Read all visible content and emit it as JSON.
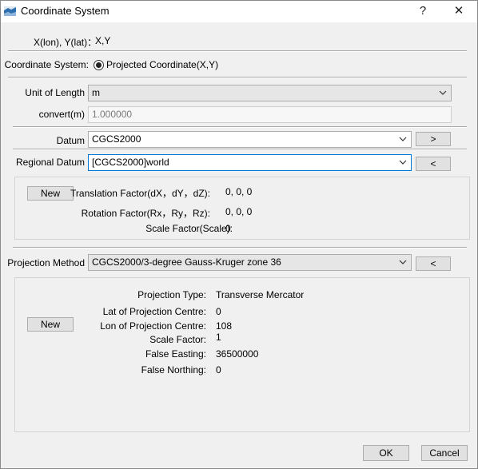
{
  "window": {
    "title": "Coordinate System",
    "help": "?",
    "close": "✕"
  },
  "xy_header": {
    "label": "X(lon), Y(lat)：",
    "value": "X,Y"
  },
  "coordinate_system": {
    "label": "Coordinate System:",
    "option": "Projected Coordinate(X,Y)",
    "selected": true
  },
  "unit": {
    "label": "Unit of Length",
    "value": "m",
    "convert_label": "convert(m)",
    "convert_value": "1.000000"
  },
  "datum": {
    "label": "Datum",
    "value": "CGCS2000",
    "button": ">"
  },
  "regional_datum": {
    "label": "Regional Datum",
    "value": "[CGCS2000]world",
    "button": "<",
    "new_button": "New",
    "translation_label": "Translation Factor(dX，dY，dZ):",
    "translation_value": "0, 0, 0",
    "rotation_label": "Rotation Factor(Rx，Ry，Rz):",
    "rotation_value": "0, 0, 0",
    "scale_label": "Scale Factor(Scale):",
    "scale_value": "0"
  },
  "projection": {
    "label": "Projection Method",
    "value": "CGCS2000/3-degree Gauss-Kruger zone 36",
    "button": "<",
    "new_button": "New",
    "params": [
      {
        "label": "Projection Type:",
        "value": "Transverse Mercator"
      },
      {
        "label": "Lat of Projection Centre:",
        "value": "0"
      },
      {
        "label": "Lon of Projection Centre:",
        "value": "108"
      },
      {
        "label": "Scale Factor:",
        "value": "1"
      },
      {
        "label": "False Easting:",
        "value": "36500000"
      },
      {
        "label": "False Northing:",
        "value": "0"
      }
    ]
  },
  "footer": {
    "ok": "OK",
    "cancel": "Cancel"
  },
  "colors": {
    "focus": "#0078d7",
    "disabled_text": "#7a7a7a"
  }
}
